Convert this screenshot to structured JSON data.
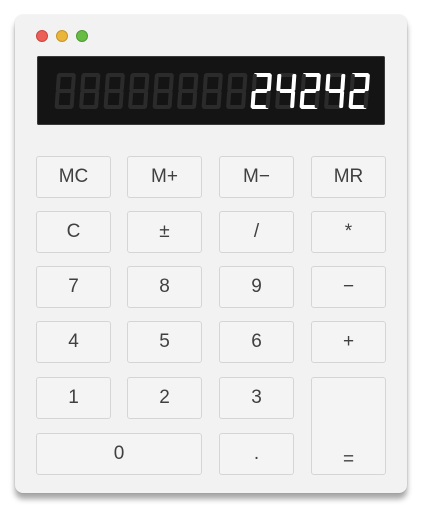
{
  "window": {
    "title_controls": [
      "close",
      "minimize",
      "maximize"
    ]
  },
  "display": {
    "value": "24242",
    "digit_count": 13,
    "colors": {
      "lit": "#ffffff",
      "unlit": "#2b2b2b",
      "background": "#141414"
    }
  },
  "keys": {
    "mc": "MC",
    "mplus": "M+",
    "mminus": "M−",
    "mr": "MR",
    "clear": "C",
    "plusminus": "±",
    "divide": "/",
    "multiply": "*",
    "seven": "7",
    "eight": "8",
    "nine": "9",
    "minus": "−",
    "four": "4",
    "five": "5",
    "six": "6",
    "plus": "+",
    "one": "1",
    "two": "2",
    "three": "3",
    "equals": "=",
    "zero": "0",
    "decimal": "."
  }
}
